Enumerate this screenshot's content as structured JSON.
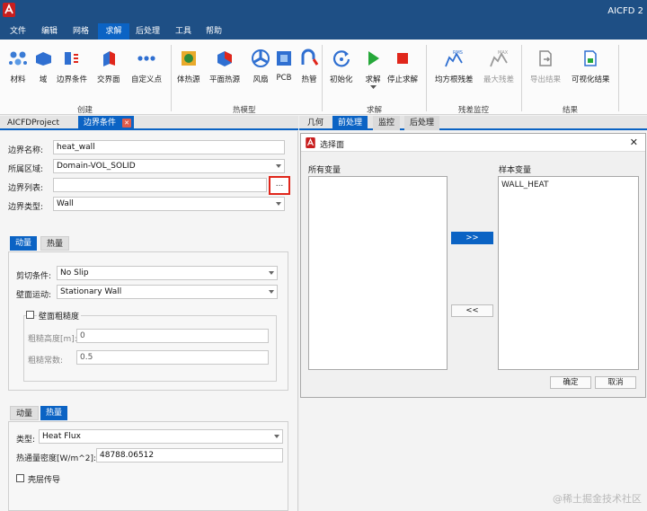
{
  "app": {
    "title": "AICFD 2"
  },
  "menu": [
    "文件",
    "编辑",
    "网格",
    "求解",
    "后处理",
    "工具",
    "帮助"
  ],
  "ribbon": {
    "groups": [
      {
        "label": "创建",
        "items": [
          "材料",
          "域",
          "边界条件",
          "交界面",
          "自定义点"
        ]
      },
      {
        "label": "热模型",
        "items": [
          "体热源",
          "平面热源",
          "风扇",
          "PCB",
          "热管"
        ]
      },
      {
        "label": "求解",
        "items": [
          "初始化",
          "求解",
          "停止求解"
        ]
      },
      {
        "label": "残差监控",
        "items": [
          "均方根残差",
          "最大残差"
        ]
      },
      {
        "label": "结果",
        "items": [
          "导出结果",
          "可视化结果"
        ]
      }
    ],
    "icon_rms": "RMS",
    "icon_max": "MAX"
  },
  "left_tabs": {
    "project": "AICFDProject",
    "boundary": "边界条件"
  },
  "boundary": {
    "name_label": "边界名称:",
    "name_value": "heat_wall",
    "region_label": "所属区域:",
    "region_value": "Domain-VOL_SOLID",
    "list_label": "边界列表:",
    "list_value": "",
    "browse_button": "...",
    "type_label": "边界类型:",
    "type_value": "Wall"
  },
  "momentum_panel": {
    "tabs": [
      "动量",
      "热量"
    ],
    "shear_label": "剪切条件:",
    "shear_value": "No Slip",
    "wall_motion_label": "壁面运动:",
    "wall_motion_value": "Stationary Wall",
    "roughness_label": "壁面粗糙度",
    "roughness_height_label": "粗糙高度[m]:",
    "roughness_height_value": "0",
    "roughness_const_label": "粗糙常数:",
    "roughness_const_value": "0.5"
  },
  "heat_panel": {
    "tabs": [
      "动量",
      "热量"
    ],
    "type_label": "类型:",
    "type_value": "Heat Flux",
    "flux_label": "热通量密度[W/m^2]:",
    "flux_value": "48788.06512",
    "shell_label": "壳层传导"
  },
  "right_tabs": [
    "几何",
    "前处理",
    "监控",
    "后处理"
  ],
  "dialog": {
    "title": "选择面",
    "all_vars_label": "所有变量",
    "sample_vars_label": "样本变量",
    "all_vars": [],
    "sample_vars": [
      "WALL_HEAT"
    ],
    "add_button": ">>",
    "remove_button": "<<",
    "ok_button": "确定",
    "cancel_button": "取消",
    "close_glyph": "✕"
  },
  "watermark": "@稀土掘金技术社区",
  "colors": {
    "brand": "#1e4f85",
    "accent": "#0b63c4",
    "highlight": "#e0261b"
  }
}
